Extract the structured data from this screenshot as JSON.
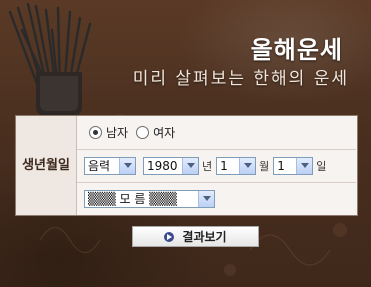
{
  "header": {
    "title": "올해운세",
    "subtitle": "미리 살펴보는 한해의 운세"
  },
  "form": {
    "label": "생년월일",
    "gender": {
      "options": [
        "남자",
        "여자"
      ],
      "selected": "남자"
    },
    "calendar": "음력",
    "year": "1980",
    "year_unit": "년",
    "month": "1",
    "month_unit": "월",
    "day": "1",
    "day_unit": "일",
    "time": "▒▒▒ 모 름 ▒▒▒"
  },
  "actions": {
    "submit": "결과보기"
  },
  "colors": {
    "background": "#4a2f1f",
    "panel": "#f6f3f1",
    "accent": "#3a4b8a"
  }
}
